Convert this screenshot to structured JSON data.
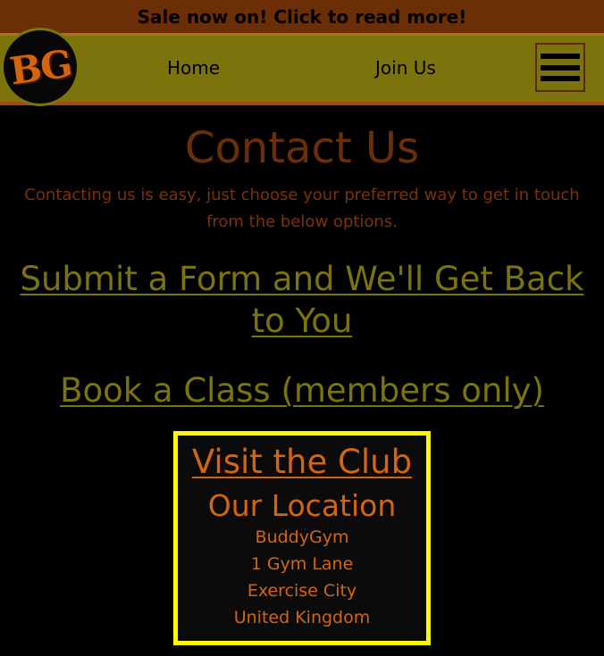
{
  "banner": {
    "text": "Sale now on! Click to read more!"
  },
  "header": {
    "logo_text": "BG",
    "nav": [
      {
        "label": "Home"
      },
      {
        "label": "Join Us"
      }
    ]
  },
  "main": {
    "title": "Contact Us",
    "intro": "Contacting us is easy, just choose your preferred way to get in touch from the below options.",
    "links": {
      "form": "Submit a Form and We'll Get Back to You",
      "book": "Book a Class (members only)"
    },
    "visit": {
      "link_label": "Visit the Club",
      "location_heading": "Our Location",
      "address": [
        "BuddyGym",
        "1 Gym Lane",
        "Exercise City",
        "United Kingdom"
      ]
    }
  },
  "colors": {
    "banner_bg": "#6b2e07",
    "nav_bg": "#7b730c",
    "accent_orange": "#d4650e",
    "olive_link": "#7b730c",
    "highlight_border": "#fffa00",
    "page_bg": "#000000"
  }
}
